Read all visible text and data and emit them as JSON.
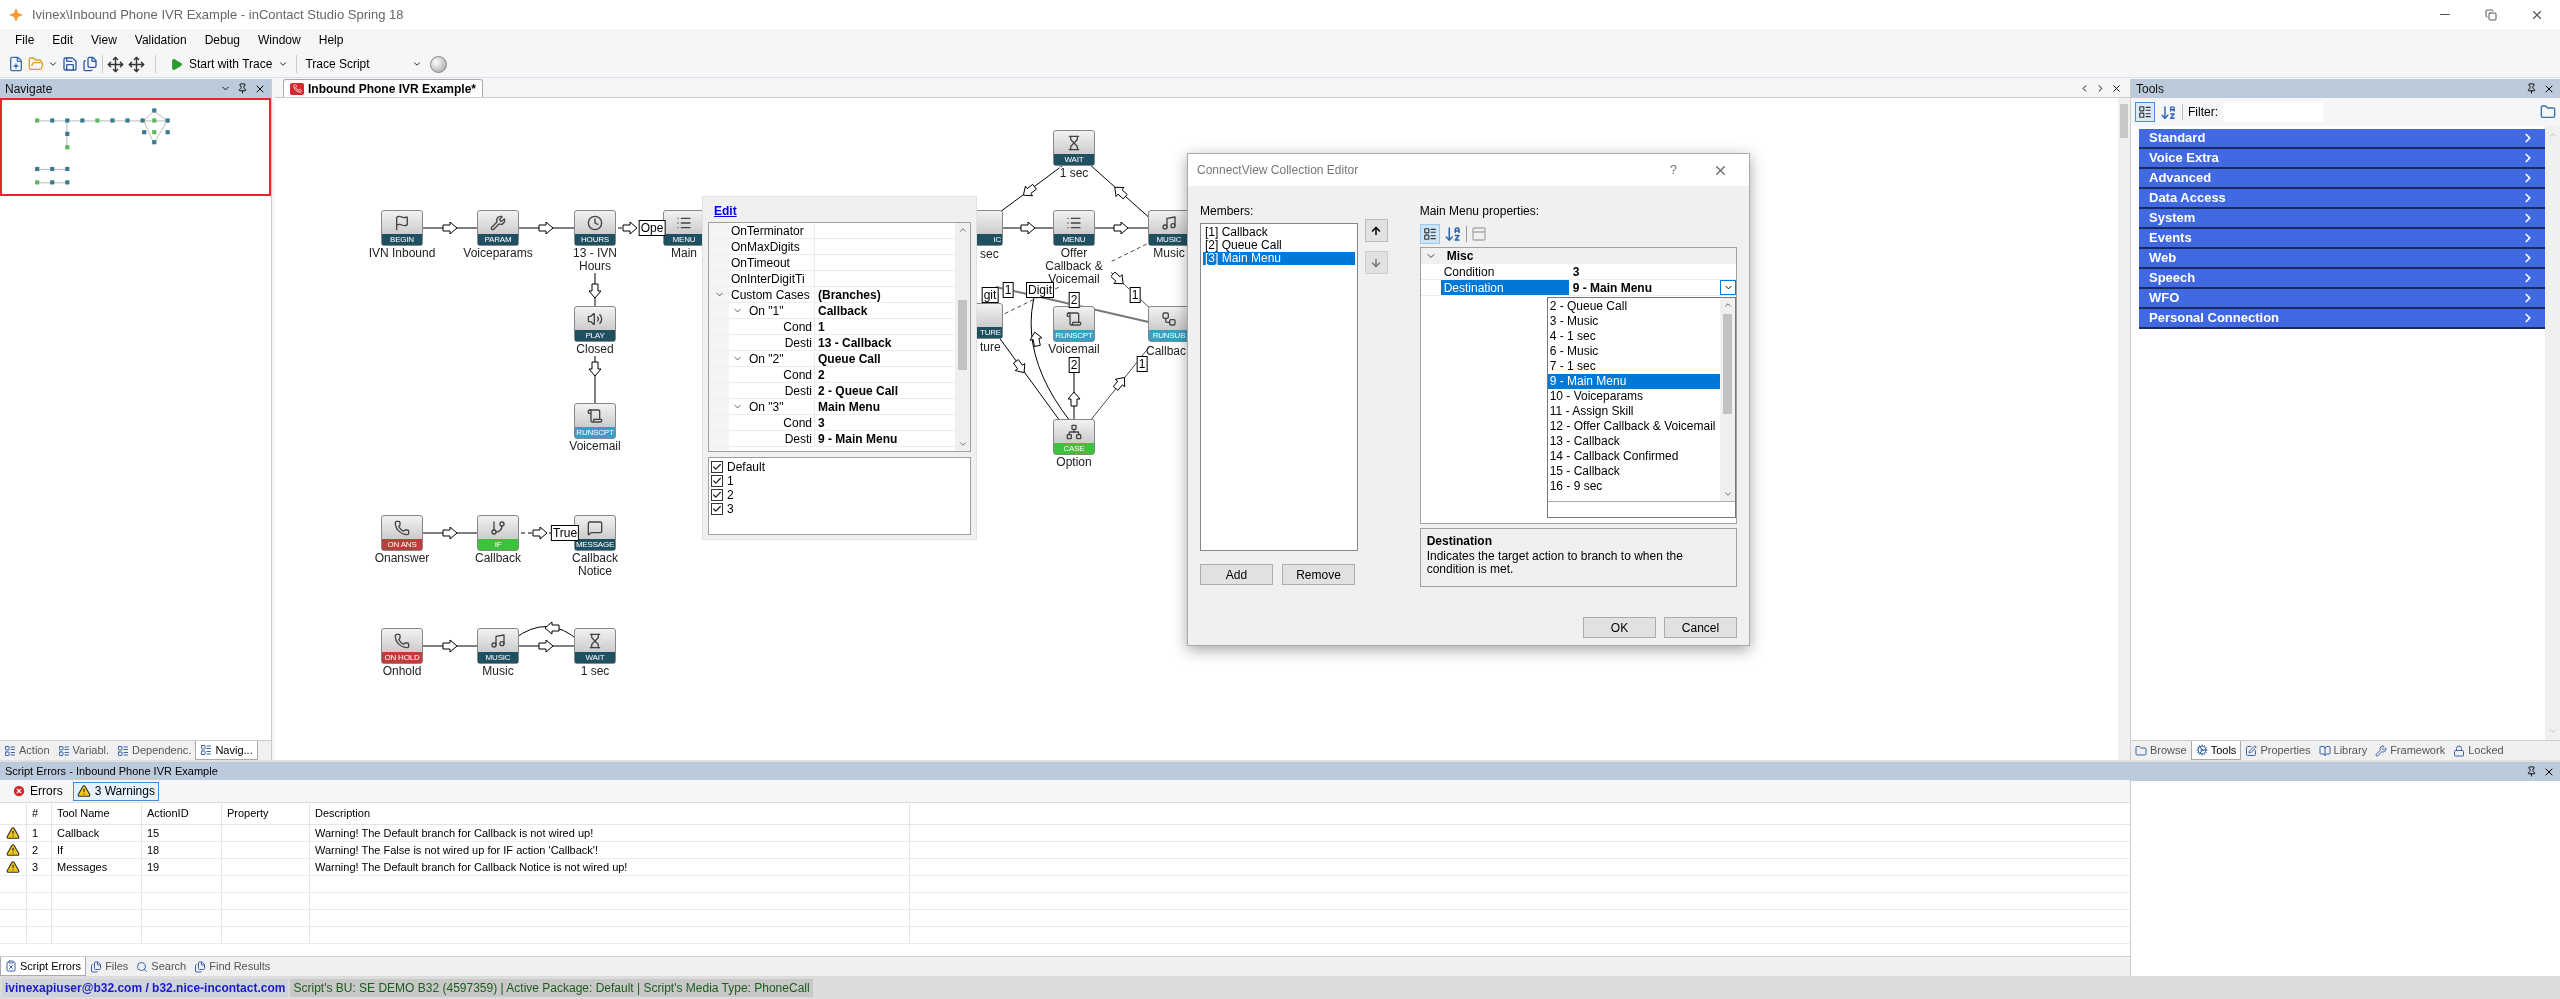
{
  "window": {
    "title": "Ivinex\\Inbound Phone IVR Example - inContact Studio Spring 18"
  },
  "menu": [
    "File",
    "Edit",
    "View",
    "Validation",
    "Debug",
    "Window",
    "Help"
  ],
  "toolbar": {
    "start_button": "Start with Trace",
    "trace_select": "Trace Script"
  },
  "navigate_panel": {
    "title": "Navigate",
    "tabs": [
      {
        "label": "Action",
        "selected": false
      },
      {
        "label": "Variabl.",
        "selected": false
      },
      {
        "label": "Dependenc.",
        "selected": false
      },
      {
        "label": "Navig...",
        "selected": true
      }
    ]
  },
  "document": {
    "tabs": [
      {
        "label": "Inbound Phone IVR Example*",
        "selected": true
      }
    ]
  },
  "canvas": {
    "nodes": [
      {
        "label": "IVN Inbound",
        "badge": "BEGIN",
        "kind": "begin"
      },
      {
        "label": "Voiceparams",
        "badge": "PARAM",
        "kind": "param"
      },
      {
        "label": "13 - IVN Hours",
        "badge": "HOURS",
        "kind": "hours"
      },
      {
        "label": "Main",
        "badge": "MENU",
        "kind": "menu"
      },
      {
        "label": "Closed",
        "badge": "PLAY",
        "kind": "play"
      },
      {
        "label": "Voicemail",
        "badge": "RUNSCPT",
        "kind": "runscript"
      },
      {
        "label": "Onanswer",
        "badge": "ON ANS",
        "kind": "onanswer"
      },
      {
        "label": "Callback",
        "badge": "IF",
        "kind": "if"
      },
      {
        "label": "Callback Notice",
        "badge": "MESSAGE",
        "kind": "message"
      },
      {
        "label": "Onhold",
        "badge": "ON HOLD",
        "kind": "onhold"
      },
      {
        "label": "Music",
        "badge": "MUSIC",
        "kind": "music"
      },
      {
        "label": "1 sec",
        "badge": "WAIT",
        "kind": "wait"
      },
      {
        "label": "1 sec",
        "badge": "WAIT",
        "kind": "wait"
      },
      {
        "label": "sec",
        "badge": "IC",
        "kind": "music"
      },
      {
        "label": "Offer Callback & Voicemail",
        "badge": "MENU",
        "kind": "menu"
      },
      {
        "label": "Music",
        "badge": "MUSIC",
        "kind": "music"
      },
      {
        "label": "ture",
        "badge": "TURE",
        "kind": "capture"
      },
      {
        "label": "Voicemail",
        "badge": "RUNSCPT",
        "kind": "runscript"
      },
      {
        "label": "Callbac",
        "badge": "RUNSUB",
        "kind": "runsub"
      },
      {
        "label": "Option",
        "badge": "CASE",
        "kind": "case"
      }
    ],
    "edge_labels": [
      "Ope",
      "True",
      "git",
      "1",
      "Digit",
      "2",
      "1",
      "2",
      "1"
    ]
  },
  "branch_popup": {
    "link": "Edit",
    "rows": [
      {
        "name": "OnTerminator"
      },
      {
        "name": "OnMaxDigits"
      },
      {
        "name": "OnTimeout"
      },
      {
        "name": "OnInterDigitTi"
      },
      {
        "name": "Custom Cases",
        "value": "(Branches)",
        "expanded": true,
        "children": [
          {
            "name": "On \"1\"",
            "value": "Callback",
            "expanded": true,
            "children": [
              {
                "name": "Cond",
                "value": "1"
              },
              {
                "name": "Desti",
                "value": "13 - Callback"
              }
            ]
          },
          {
            "name": "On \"2\"",
            "value": "Queue Call",
            "expanded": true,
            "children": [
              {
                "name": "Cond",
                "value": "2"
              },
              {
                "name": "Desti",
                "value": "2 - Queue Call"
              }
            ]
          },
          {
            "name": "On \"3\"",
            "value": "Main Menu",
            "expanded": true,
            "children": [
              {
                "name": "Cond",
                "value": "3"
              },
              {
                "name": "Desti",
                "value": "9 - Main Menu"
              }
            ]
          }
        ]
      }
    ],
    "checklist": [
      {
        "label": "Default",
        "checked": true
      },
      {
        "label": "1",
        "checked": true
      },
      {
        "label": "2",
        "checked": true
      },
      {
        "label": "3",
        "checked": true
      }
    ]
  },
  "dialog": {
    "title": "ConnectView Collection Editor",
    "help": "?",
    "members_label": "Members:",
    "members": [
      {
        "label": "[1] Callback",
        "selected": false
      },
      {
        "label": "[2] Queue Call",
        "selected": false
      },
      {
        "label": "[3] Main Menu",
        "selected": true
      }
    ],
    "properties_label": "Main Menu properties:",
    "category": "Misc",
    "properties": [
      {
        "name": "Condition",
        "value": "3",
        "selected": false
      },
      {
        "name": "Destination",
        "value": "9 - Main Menu",
        "selected": true
      }
    ],
    "dropdown": [
      {
        "label": "2 - Queue Call",
        "selected": false
      },
      {
        "label": "3 - Music",
        "selected": false
      },
      {
        "label": "4 - 1 sec",
        "selected": false
      },
      {
        "label": "6 - Music",
        "selected": false
      },
      {
        "label": "7 - 1 sec",
        "selected": false
      },
      {
        "label": "9 - Main Menu",
        "selected": true
      },
      {
        "label": "10 - Voiceparams",
        "selected": false
      },
      {
        "label": "11 - Assign Skill",
        "selected": false
      },
      {
        "label": "12 - Offer Callback & Voicemail",
        "selected": false
      },
      {
        "label": "13 - Callback",
        "selected": false
      },
      {
        "label": "14 - Callback Confirmed",
        "selected": false
      },
      {
        "label": "15 - Callback",
        "selected": false
      },
      {
        "label": "16 - 9 sec",
        "selected": false
      }
    ],
    "description_title": "Destination",
    "description": "Indicates the target action to branch to when the condition is met.",
    "buttons": {
      "add": "Add",
      "remove": "Remove",
      "ok": "OK",
      "cancel": "Cancel"
    }
  },
  "tools_panel": {
    "title": "Tools",
    "filter_label": "Filter:",
    "categories": [
      "Standard",
      "Voice Extra",
      "Advanced",
      "Data Access",
      "System",
      "Events",
      "Web",
      "Speech",
      "WFO",
      "Personal Connection"
    ],
    "tabs": [
      {
        "label": "Browse",
        "selected": false
      },
      {
        "label": "Tools",
        "selected": true
      },
      {
        "label": "Properties",
        "selected": false
      },
      {
        "label": "Library",
        "selected": false
      },
      {
        "label": "Framework",
        "selected": false
      },
      {
        "label": "Locked",
        "selected": false
      }
    ]
  },
  "script_errors": {
    "title": "Script Errors - Inbound Phone IVR Example",
    "filters": [
      {
        "label": "Errors",
        "kind": "error",
        "selected": false
      },
      {
        "label": "3 Warnings",
        "kind": "warning",
        "selected": true
      }
    ],
    "columns": [
      "#",
      "Tool Name",
      "ActionID",
      "Property",
      "Description"
    ],
    "rows": [
      {
        "kind": "warning",
        "number": "1",
        "tool": "Callback",
        "action_id": "15",
        "description": "Warning! The Default branch for Callback is not wired up!"
      },
      {
        "kind": "warning",
        "number": "2",
        "tool": "If",
        "action_id": "18",
        "description": "Warning! The False is not wired up for IF action 'Callback'!"
      },
      {
        "kind": "warning",
        "number": "3",
        "tool": "Messages",
        "action_id": "19",
        "description": "Warning! The Default branch for Callback Notice is not wired up!"
      }
    ],
    "tabs": [
      {
        "label": "Script Errors",
        "selected": true
      },
      {
        "label": "Files",
        "selected": false
      },
      {
        "label": "Search",
        "selected": false
      },
      {
        "label": "Find Results",
        "selected": false
      }
    ]
  },
  "status_bar": {
    "user": "ivinexapiuser@b32.com / b32.nice-incontact.com",
    "info": "Script's BU: SE DEMO B32 (4597359) | Active Package: Default | Script's Media Type: PhoneCall"
  }
}
